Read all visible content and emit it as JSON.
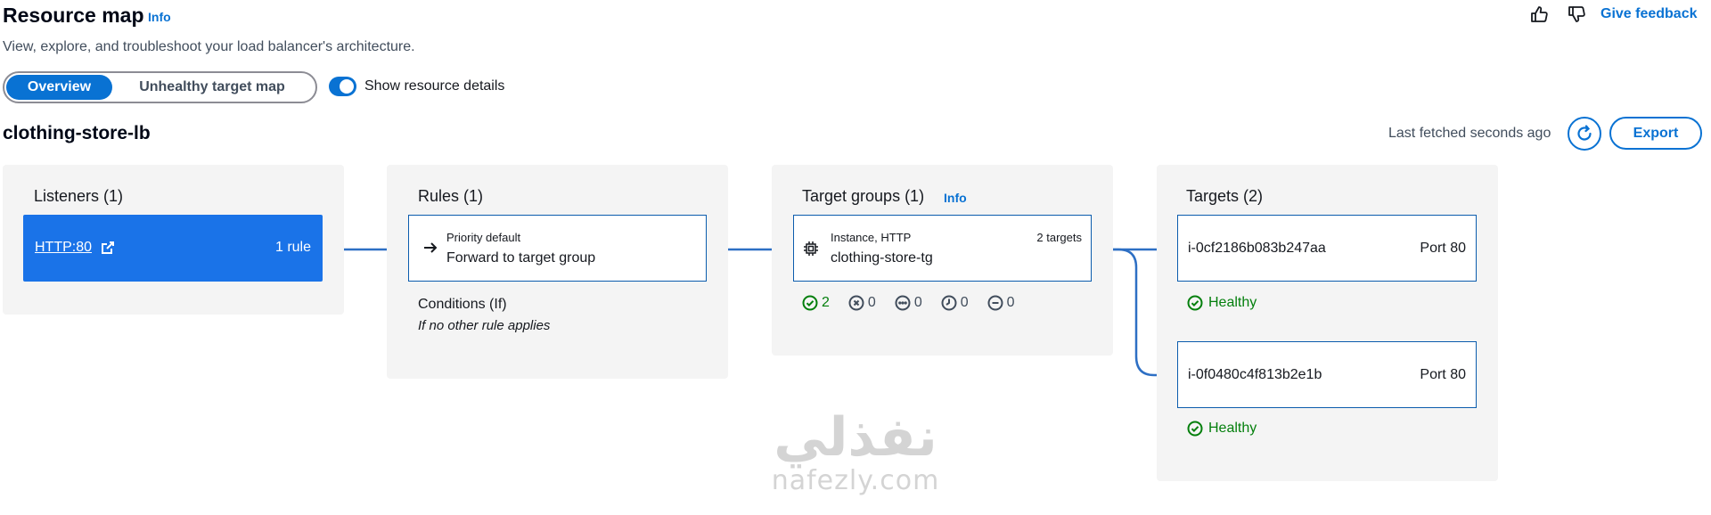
{
  "header": {
    "title": "Resource map",
    "info": "Info",
    "subtitle": "View, explore, and troubleshoot your load balancer's architecture.",
    "give_feedback": "Give feedback"
  },
  "view_toggle": {
    "tabs": [
      {
        "label": "Overview",
        "selected": true
      },
      {
        "label": "Unhealthy target map",
        "selected": false
      }
    ],
    "show_details_label": "Show resource details",
    "show_details_on": true
  },
  "load_balancer": {
    "name": "clothing-store-lb",
    "last_fetched": "Last fetched seconds ago",
    "export_label": "Export"
  },
  "listeners": {
    "title": "Listeners (1)",
    "items": [
      {
        "protocol_port": "HTTP:80",
        "rules": "1 rule"
      }
    ]
  },
  "rules": {
    "title": "Rules (1)",
    "items": [
      {
        "priority": "Priority default",
        "action": "Forward to target group"
      }
    ],
    "conditions_title": "Conditions (If)",
    "conditions_text": "If no other rule applies"
  },
  "target_groups": {
    "title": "Target groups (1)",
    "info": "Info",
    "items": [
      {
        "type": "Instance, HTTP",
        "targets": "2 targets",
        "name": "clothing-store-tg"
      }
    ],
    "status_counts": {
      "healthy": "2",
      "unhealthy": "0",
      "unused": "0",
      "draining": "0",
      "unavailable": "0"
    }
  },
  "targets": {
    "title": "Targets (2)",
    "items": [
      {
        "id": "i-0cf2186b083b247aa",
        "port": "Port 80",
        "status": "Healthy"
      },
      {
        "id": "i-0f0480c4f813b2e1b",
        "port": "Port 80",
        "status": "Healthy"
      }
    ]
  },
  "watermark": {
    "arabic": "نفذلي",
    "latin": "nafezly.com"
  },
  "colors": {
    "accent": "#0972d3",
    "listener_fill": "#1a73e8",
    "healthy": "#037f0c",
    "connector": "#2d6fc4"
  }
}
